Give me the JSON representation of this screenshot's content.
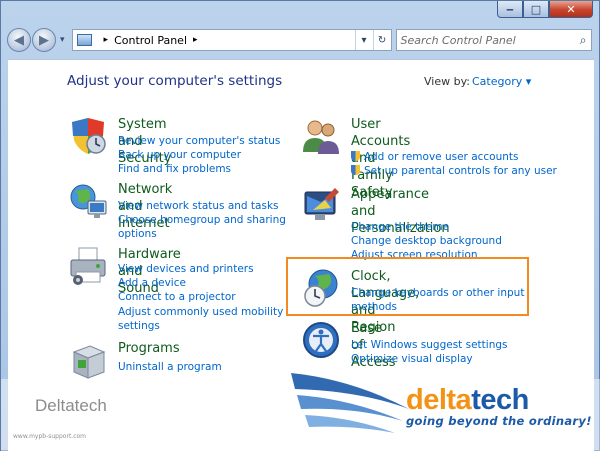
{
  "window": {
    "minimize_glyph": "‒",
    "maximize_glyph": "□",
    "close_glyph": "✕"
  },
  "nav": {
    "back_glyph": "◀",
    "forward_glyph": "▶",
    "recent_glyph": "▾",
    "breadcrumb": "Control Panel",
    "breadcrumb_sep": "▸",
    "dropdown_glyph": "▾",
    "refresh_glyph": "↻",
    "search_placeholder": "Search Control Panel",
    "search_glyph": "⌕"
  },
  "main": {
    "heading": "Adjust your computer's settings",
    "view_by_label": "View by:",
    "view_by_value": "Category ▾"
  },
  "left_categories": [
    {
      "title": "System and Security",
      "links": [
        "Review your computer's status",
        "Back up your computer",
        "Find and fix problems"
      ]
    },
    {
      "title": "Network and Internet",
      "links": [
        "View network status and tasks",
        "Choose homegroup and sharing",
        "options"
      ]
    },
    {
      "title": "Hardware and Sound",
      "links": [
        "View devices and printers",
        "Add a device",
        "Connect to a projector",
        "Adjust commonly used mobility",
        "settings"
      ]
    },
    {
      "title": "Programs",
      "links": [
        "Uninstall a program"
      ]
    }
  ],
  "right_categories": [
    {
      "title_lines": [
        "User Accounts and Family",
        "Safety"
      ],
      "links": [
        "Add or remove user accounts",
        "Set up parental controls for any user"
      ]
    },
    {
      "title_lines": [
        "Appearance and",
        "Personalization"
      ],
      "links": [
        "Change the theme",
        "Change desktop background",
        "Adjust screen resolution"
      ]
    },
    {
      "title_lines": [
        "Clock, Language, and Region"
      ],
      "links": [
        "Change keyboards or other input",
        "methods"
      ]
    },
    {
      "title_lines": [
        "Ease of Access"
      ],
      "links": [
        "Let Windows suggest settings",
        "Optimize visual display"
      ]
    }
  ],
  "watermark": {
    "left_text": "Deltatech",
    "url": "www.mypb-support.com",
    "logo_part1": "delta",
    "logo_part2": "tech",
    "tagline": "going beyond the ordinary!"
  },
  "colors": {
    "title_green": "#0e5a1c",
    "link_blue": "#0066cc",
    "heading_blue": "#1e3287",
    "highlight_orange": "#f28a20"
  }
}
